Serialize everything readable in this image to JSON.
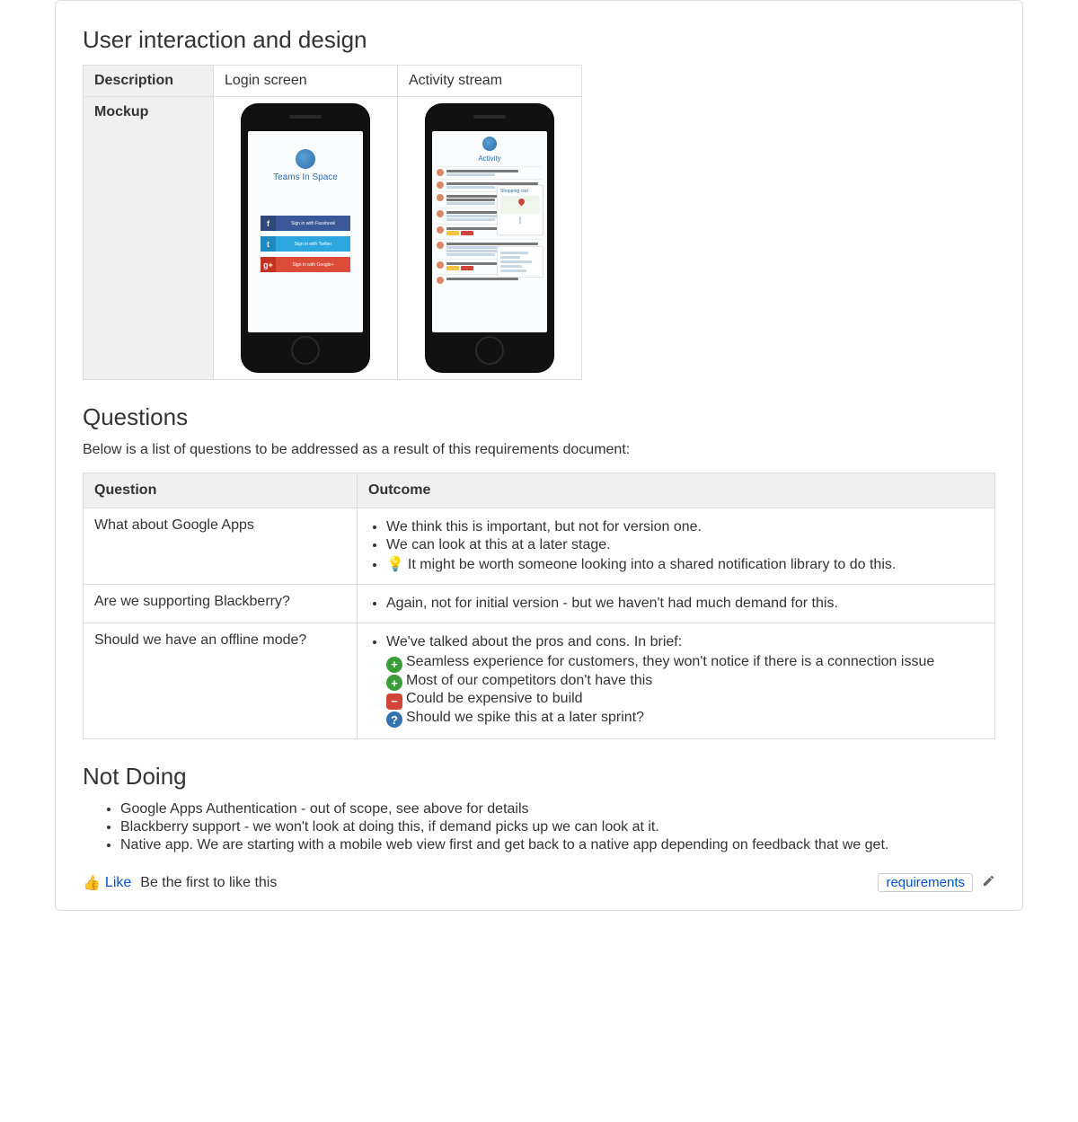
{
  "sections": {
    "design_heading": "User interaction and design",
    "questions_heading": "Questions",
    "questions_intro": "Below is a list of questions to be addressed as a result of this requirements document:",
    "not_doing_heading": "Not Doing"
  },
  "mock_table": {
    "row_description": "Description",
    "row_mockup": "Mockup",
    "cols": [
      "Login screen",
      "Activity stream"
    ]
  },
  "login_mock": {
    "brand": "Teams In Space",
    "facebook": "Sign in with Facebook",
    "twitter": "Sign in with Twitter",
    "google": "Sign in with Google+"
  },
  "activity_mock": {
    "title": "Activity",
    "card_title": "Shopping cart"
  },
  "q_table": {
    "headers": [
      "Question",
      "Outcome"
    ],
    "rows": [
      {
        "question": "What about Google Apps",
        "outcome": [
          {
            "type": "text",
            "text": "We think this is important, but not for version one."
          },
          {
            "type": "text",
            "text": "We can look at this at a later stage."
          },
          {
            "type": "bulb",
            "text": "It might be worth someone looking into a shared notification library to do this."
          }
        ]
      },
      {
        "question": "Are we supporting Blackberry?",
        "outcome": [
          {
            "type": "text",
            "text": "Again, not for initial version - but we haven't had much demand for this."
          }
        ]
      },
      {
        "question": "Should we have an offline mode?",
        "outcome_lead": "We've talked about the pros and cons. In brief:",
        "outcome_sub": [
          {
            "type": "plus",
            "text": "Seamless experience for customers, they won't notice if there is a connection issue"
          },
          {
            "type": "plus",
            "text": "Most of our competitors don't have this"
          },
          {
            "type": "minus",
            "text": "Could be expensive to build"
          },
          {
            "type": "q",
            "text": "Should we spike this at a later sprint?"
          }
        ]
      }
    ]
  },
  "not_doing": [
    "Google Apps Authentication - out of scope, see above for details",
    "Blackberry support - we won't look at doing this, if demand picks up we can look at it.",
    "Native app. We are starting with a mobile web view first and get back to a native app depending on feedback that we get."
  ],
  "footer": {
    "like": "Like",
    "first": "Be the first to like this",
    "tag": "requirements"
  }
}
